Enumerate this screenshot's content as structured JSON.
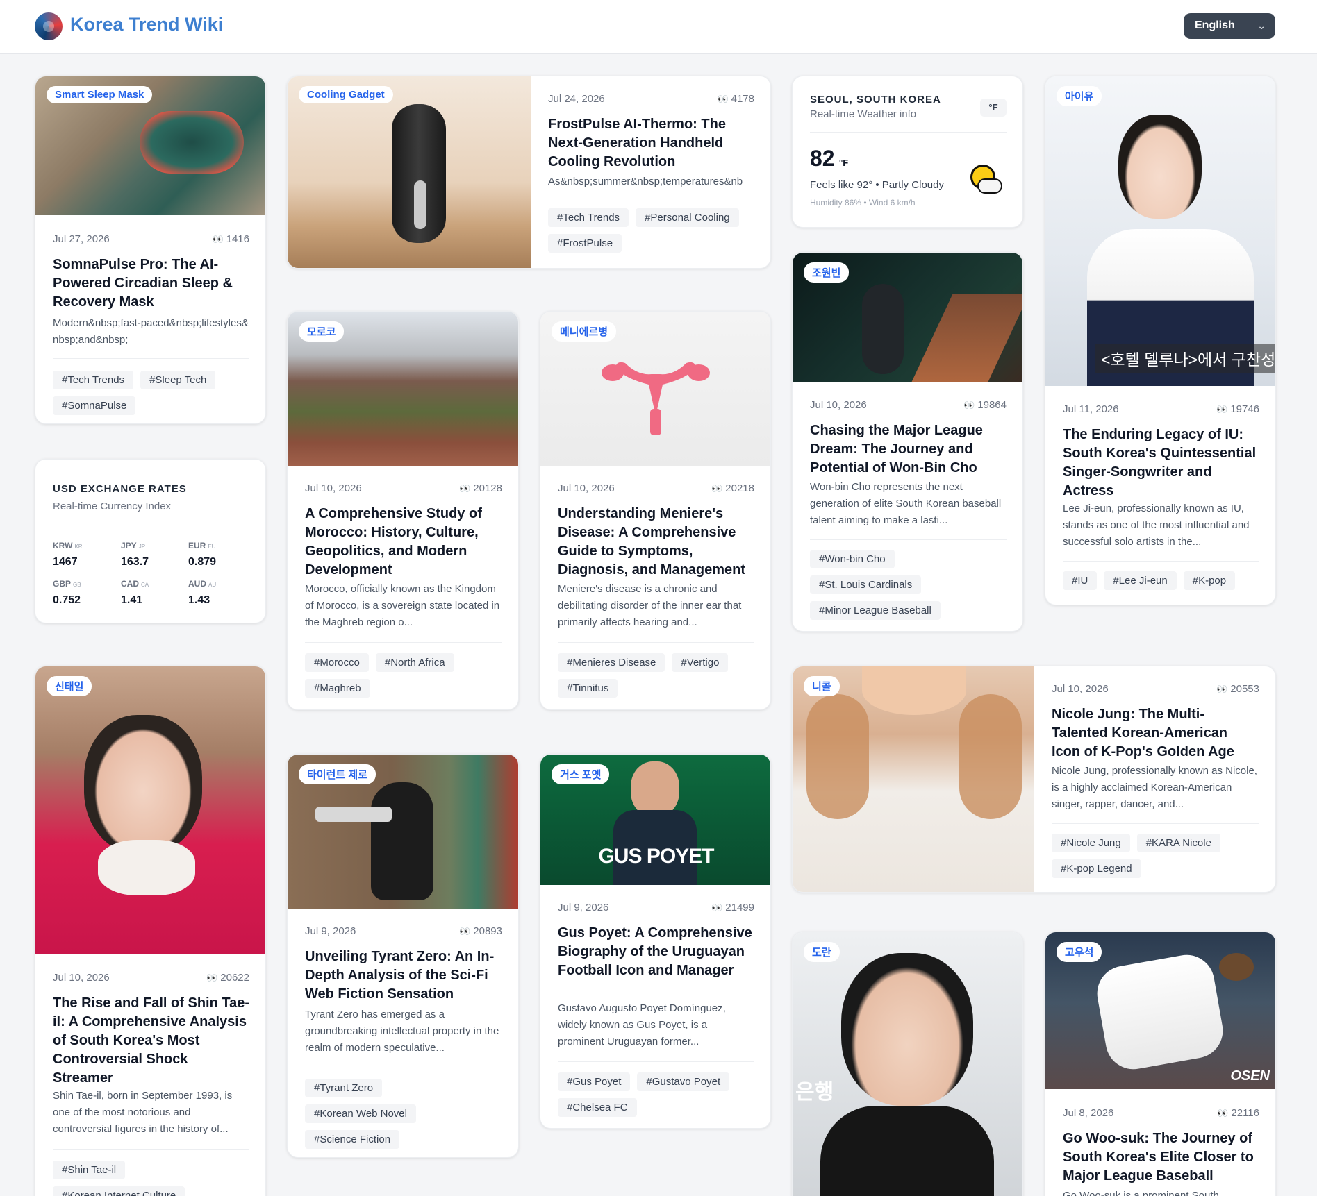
{
  "header": {
    "site_title": "Korea Trend Wiki",
    "language": "English"
  },
  "exchange": {
    "title": "USD EXCHANGE RATES",
    "subtitle": "Real-time Currency Index",
    "rates": [
      {
        "code": "KRW",
        "flag": "KR",
        "value": "1467"
      },
      {
        "code": "JPY",
        "flag": "JP",
        "value": "163.7"
      },
      {
        "code": "EUR",
        "flag": "EU",
        "value": "0.879"
      },
      {
        "code": "GBP",
        "flag": "GB",
        "value": "0.752"
      },
      {
        "code": "CAD",
        "flag": "CA",
        "value": "1.41"
      },
      {
        "code": "AUD",
        "flag": "AU",
        "value": "1.43"
      }
    ]
  },
  "weather": {
    "city": "SEOUL, SOUTH KOREA",
    "subtitle": "Real-time Weather info",
    "unit_toggle": "°F",
    "temp": "82",
    "temp_unit": "°F",
    "feels": "Feels like 92° • Partly Cloudy",
    "extra": "Humidity 86% • Wind 6 km/h"
  },
  "cards": [
    {
      "badge": "Smart Sleep Mask",
      "date": "Jul 27, 2026",
      "views": "1416",
      "title": "SomnaPulse Pro: The AI-Powered Circadian Sleep & Recovery Mask",
      "desc": "Modern&nbsp;fast-paced&nbsp;lifestyles&nbsp;and&nbsp;",
      "tags": [
        "#Tech Trends",
        "#Sleep Tech",
        "#SomnaPulse"
      ]
    },
    {
      "badge": "Cooling Gadget",
      "date": "Jul 24, 2026",
      "views": "4178",
      "title": "FrostPulse AI-Thermo: The Next-Generation Handheld Cooling Revolution",
      "desc": "As&nbsp;summer&nbsp;temperatures&nb",
      "tags": [
        "#Tech Trends",
        "#Personal Cooling",
        "#FrostPulse"
      ]
    },
    {
      "badge": "아이유",
      "date": "Jul 11, 2026",
      "views": "19746",
      "title": "The Enduring Legacy of IU: South Korea's Quintessential Singer-Songwriter and Actress",
      "desc": "Lee Ji-eun, professionally known as IU, stands as one of the most influential and successful solo artists in the...",
      "tags": [
        "#IU",
        "#Lee Ji-eun",
        "#K-pop"
      ],
      "caption": "<호텔 델루나>에서 구찬성"
    },
    {
      "badge": "조원빈",
      "date": "Jul 10, 2026",
      "views": "19864",
      "title": "Chasing the Major League Dream: The Journey and Potential of Won-Bin Cho",
      "desc": "Won-bin Cho represents the next generation of elite South Korean baseball talent aiming to make a lasti...",
      "tags": [
        "#Won-bin Cho",
        "#St. Louis Cardinals",
        "#Minor League Baseball"
      ]
    },
    {
      "badge": "모로코",
      "date": "Jul 10, 2026",
      "views": "20128",
      "title": "A Comprehensive Study of Morocco: History, Culture, Geopolitics, and Modern Development",
      "desc": "Morocco, officially known as the Kingdom of Morocco, is a sovereign state located in the Maghreb region o...",
      "tags": [
        "#Morocco",
        "#North Africa",
        "#Maghreb"
      ]
    },
    {
      "badge": "메니에르병",
      "date": "Jul 10, 2026",
      "views": "20218",
      "title": "Understanding Meniere's Disease: A Comprehensive Guide to Symptoms, Diagnosis, and Management",
      "desc": "Meniere's disease is a chronic and debilitating disorder of the inner ear that primarily affects hearing and...",
      "tags": [
        "#Menieres Disease",
        "#Vertigo",
        "#Tinnitus"
      ]
    },
    {
      "badge": "신태일",
      "date": "Jul 10, 2026",
      "views": "20622",
      "title": "The Rise and Fall of Shin Tae-il: A Comprehensive Analysis of South Korea's Most Controversial Shock Streamer",
      "desc": "Shin Tae-il, born in September 1993, is one of the most notorious and controversial figures in the history of...",
      "tags": [
        "#Shin Tae-il",
        "#Korean Internet Culture"
      ]
    },
    {
      "badge": "니콜",
      "date": "Jul 10, 2026",
      "views": "20553",
      "title": "Nicole Jung: The Multi-Talented Korean-American Icon of K-Pop's Golden Age",
      "desc": "Nicole Jung, professionally known as Nicole, is a highly acclaimed Korean-American singer, rapper, dancer, and...",
      "tags": [
        "#Nicole Jung",
        "#KARA Nicole",
        "#K-pop Legend"
      ]
    },
    {
      "badge": "타이런트 제로",
      "date": "Jul 9, 2026",
      "views": "20893",
      "title": "Unveiling Tyrant Zero: An In-Depth Analysis of the Sci-Fi Web Fiction Sensation",
      "desc": "Tyrant Zero has emerged as a groundbreaking intellectual property in the realm of modern speculative...",
      "tags": [
        "#Tyrant Zero",
        "#Korean Web Novel",
        "#Science Fiction"
      ]
    },
    {
      "badge": "거스 포옛",
      "date": "Jul 9, 2026",
      "views": "21499",
      "title": "Gus Poyet: A Comprehensive Biography of the Uruguayan Football Icon and Manager",
      "desc": "Gustavo Augusto Poyet Domínguez, widely known as Gus Poyet, is a prominent Uruguayan former...",
      "tags": [
        "#Gus Poyet",
        "#Gustavo Poyet",
        "#Chelsea FC"
      ],
      "caption": "GUS POYET"
    },
    {
      "badge": "도란",
      "caption": "은행"
    },
    {
      "badge": "고우석",
      "date": "Jul 8, 2026",
      "views": "22116",
      "title": "Go Woo-suk: The Journey of South Korea's Elite Closer to Major League Baseball",
      "desc": "Go Woo-suk is a prominent South",
      "tags": [],
      "caption": "OSEN"
    }
  ]
}
